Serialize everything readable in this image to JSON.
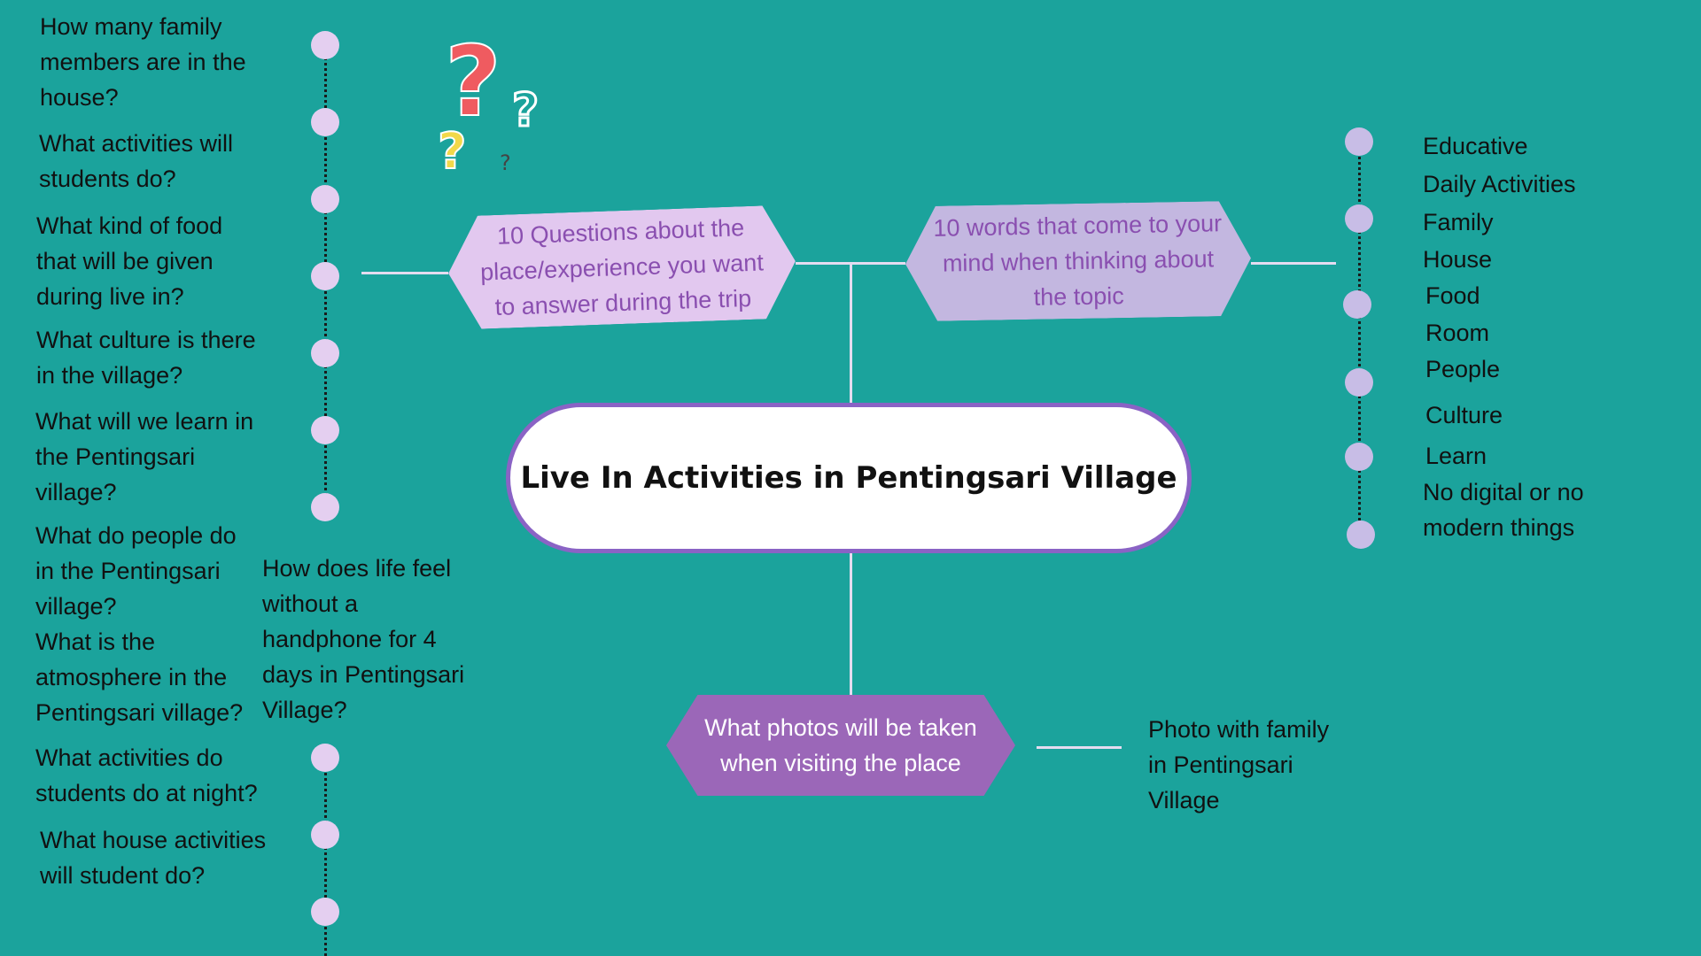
{
  "colors": {
    "background": "#1ba39c",
    "question_dot": "#e4cff0",
    "word_dot": "#c8bde6",
    "questions_node": "#e2c8ef",
    "words_node": "#c3b7e0",
    "photos_node": "#9b67b8",
    "center_border": "#8a63c5",
    "node_text": "#8a4fb0",
    "photos_text": "#ffffff"
  },
  "central": {
    "title": "Live In Activities in Pentingsari Village"
  },
  "questions_node": {
    "label": "10 Questions about the place/experience you want to answer during the trip"
  },
  "words_node": {
    "label": "10 words that come to your mind when thinking about the topic"
  },
  "photos_node": {
    "label": "What photos will be taken when visiting the place"
  },
  "questions": [
    "How many family members are in the house?",
    "What activities will students do?",
    "What kind of food that will be given during live in?",
    "What culture is there in the village?",
    "What will we learn in the Pentingsari village?",
    "What do people do in the Pentingsari village?",
    "What is the atmosphere in the Pentingsari village?",
    "How does life feel without a handphone for 4 days in Pentingsari Village?",
    "What activities do students do at night?",
    "What house activities will student do?"
  ],
  "words": [
    "Educative",
    "Daily Activities",
    "Family",
    "House",
    "Food",
    "Room",
    "People",
    "Culture",
    "Learn",
    "No digital or no modern things"
  ],
  "photos": [
    "Photo with family in Pentingsari Village"
  ],
  "decoration": {
    "icon": "question-marks-icon"
  }
}
